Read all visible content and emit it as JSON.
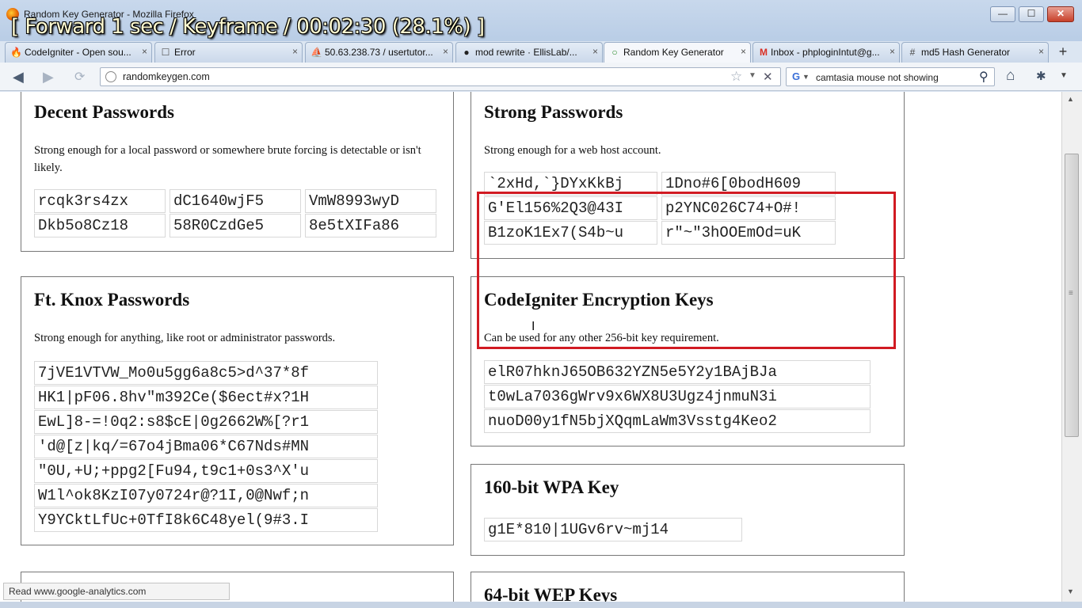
{
  "window": {
    "title": "Random Key Generator - Mozilla Firefox",
    "overlay": "[ Forward 1 sec / Keyframe / 00:02:30 (28.1%) ]",
    "minimize_glyph": "—",
    "maximize_glyph": "☐",
    "close_glyph": "✕"
  },
  "tabs": [
    {
      "label": "CodeIgniter - Open sou...",
      "icon": "codeigniter-icon",
      "glyph": "🔥"
    },
    {
      "label": "Error",
      "icon": "blank-page-icon",
      "glyph": "☐"
    },
    {
      "label": "50.63.238.73 / usertutor...",
      "icon": "phpmyadmin-icon",
      "glyph": "⛵"
    },
    {
      "label": "mod rewrite · EllisLab/...",
      "icon": "github-icon",
      "glyph": "●"
    },
    {
      "label": "Random Key Generator",
      "icon": "loading-icon",
      "glyph": "○",
      "active": true
    },
    {
      "label": "Inbox - phploginIntut@g...",
      "icon": "gmail-icon",
      "glyph": "M"
    },
    {
      "label": "md5 Hash Generator",
      "icon": "md5-icon",
      "glyph": "#"
    }
  ],
  "tab_close_glyph": "×",
  "new_tab_glyph": "+",
  "nav": {
    "back_glyph": "◀",
    "forward_glyph": "▶",
    "reload_glyph": "⟳",
    "url": "randomkeygen.com",
    "bookmark_glyph": "☆",
    "dropdown_glyph": "▼",
    "stop_glyph": "✕",
    "search_engine_glyph": "G",
    "search_query": "camtasia mouse not showing",
    "search_glyph": "⚲",
    "home_glyph": "⌂",
    "addon_glyph": "✱"
  },
  "sections": {
    "decent": {
      "title": "Decent Passwords",
      "description": "Strong enough for a local password or somewhere brute forcing is detectable or isn't likely.",
      "keys": [
        "rcqk3rs4zx",
        "dC1640wjF5",
        "VmW8993wyD",
        "Dkb5o8Cz18",
        "58R0CzdGe5",
        "8e5tXIFa86"
      ]
    },
    "strong": {
      "title": "Strong Passwords",
      "description": "Strong enough for a web host account.",
      "keys": [
        "`2xHd,`}DYxKkBj",
        "1Dno#6[0bodH609",
        "G'El156%2Q3@43I",
        "p2YNC026C74+O#!",
        "B1zoK1Ex7(S4b~u",
        "r\"~\"3hOOEmOd=uK"
      ]
    },
    "ftknox": {
      "title": "Ft. Knox Passwords",
      "description": "Strong enough for anything, like root or administrator passwords.",
      "keys": [
        "7jVE1VTVW_Mo0u5gg6a8c5>d^37*8f",
        "HK1|pF06.8hv\"m392Ce($6ect#x?1H",
        "EwL]8-=!0q2:s8$cE|0g2662W%[?r1",
        "'d@[z|kq/=67o4jBma06*C67Nds#MN",
        "\"0U,+U;+ppg2[Fu94,t9c1+0s3^X'u",
        "W1l^ok8KzI07y0724r@?1I,0@Nwf;n",
        "Y9YCktLfUc+0TfI8k6C48yel(9#3.I"
      ]
    },
    "codeigniter": {
      "title": "CodeIgniter Encryption Keys",
      "description": "Can be used for any other 256-bit key requirement.",
      "keys": [
        "elR07hknJ65OB632YZN5e5Y2y1BAjBJa",
        "t0wLa7036gWrv9x6WX8U3Ugz4jnmuN3i",
        "nuoD00y1fN5bjXQqmLaWm3Vsstg4Keo2"
      ]
    },
    "wpa": {
      "title": "160-bit WPA Key",
      "keys": [
        "g1E*810|1UGv6rv~mj14"
      ]
    },
    "wep": {
      "title": "64-bit WEP Keys"
    }
  },
  "cursor_glyph": "I",
  "scroll": {
    "up_glyph": "▲",
    "down_glyph": "▼",
    "grip": "≡"
  },
  "status": "Read www.google-analytics.com"
}
